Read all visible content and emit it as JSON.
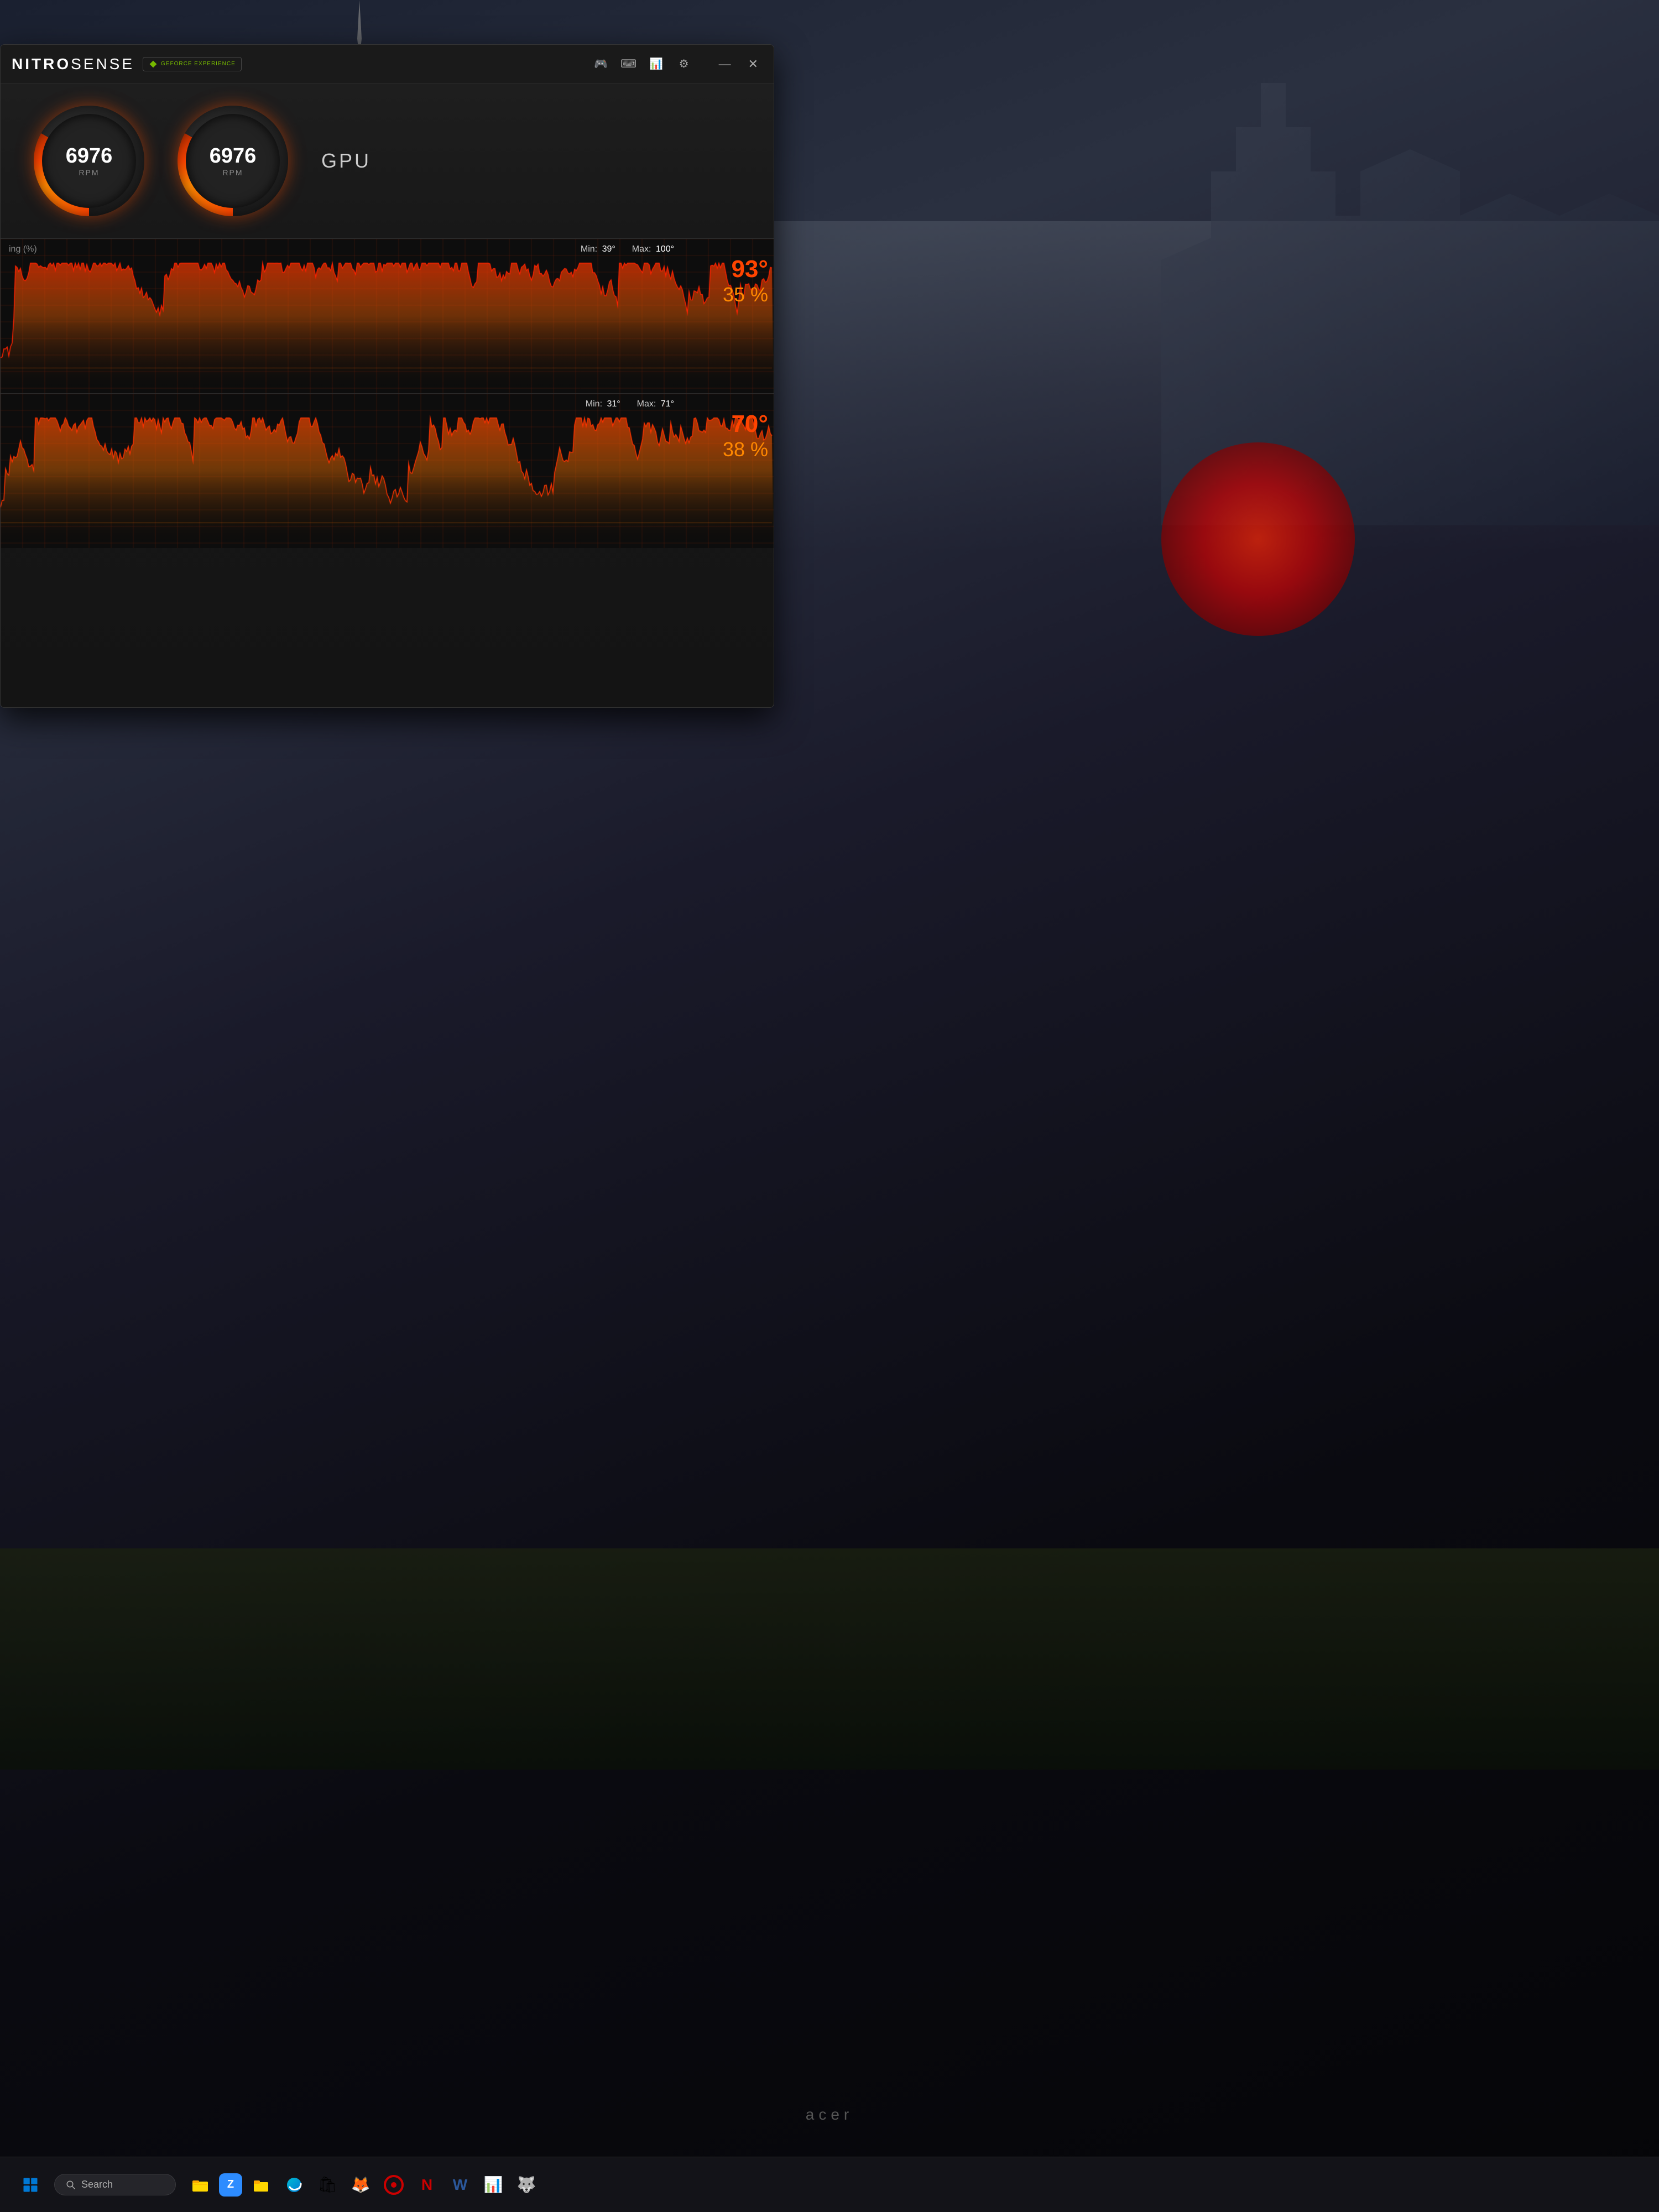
{
  "app": {
    "title_prefix": "NITRO",
    "title_suffix": "SENSE",
    "geforce": "GEFORCE EXPERIENCE"
  },
  "window": {
    "minimize": "—",
    "close": "✕"
  },
  "fans": [
    {
      "rpm": "6976",
      "unit": "RPM"
    },
    {
      "rpm": "6976",
      "unit": "RPM"
    }
  ],
  "gpu_label": "GPU",
  "graphs": [
    {
      "label": "ing (%)",
      "min_label": "Min:",
      "min_value": "39°",
      "max_label": "Max:",
      "max_value": "100°",
      "temp": "93°",
      "percent": "35 %",
      "color_temp": "#ff3300",
      "color_pct": "#ff8800"
    },
    {
      "label": "",
      "min_label": "Min:",
      "min_value": "31°",
      "max_label": "Max:",
      "max_value": "71°",
      "temp": "70°",
      "percent": "38 %",
      "color_temp": "#ff3300",
      "color_pct": "#ff8800"
    }
  ],
  "taskbar": {
    "search_placeholder": "Search",
    "icons": [
      {
        "name": "windows-start",
        "symbol": "⊞",
        "color": "#0078d4"
      },
      {
        "name": "search",
        "label": "Search"
      },
      {
        "name": "file-explorer",
        "symbol": "📁",
        "color": "#ffd700"
      },
      {
        "name": "zoom",
        "symbol": "Z",
        "color": "#2d8cff"
      },
      {
        "name": "files-app",
        "symbol": "📂",
        "color": "#ffd700"
      },
      {
        "name": "edge",
        "symbol": "e",
        "color": "#0078d4"
      },
      {
        "name": "store",
        "symbol": "🛍",
        "color": "#0078d4"
      },
      {
        "name": "firefox",
        "symbol": "🦊",
        "color": "#ff6611"
      },
      {
        "name": "circle-app",
        "symbol": "○",
        "color": "#cc0000"
      },
      {
        "name": "nitro-n",
        "symbol": "N",
        "color": "#cc0000"
      },
      {
        "name": "word",
        "symbol": "W",
        "color": "#2b579a"
      },
      {
        "name": "chart-app",
        "symbol": "📊",
        "color": "#217346"
      },
      {
        "name": "wolf-app",
        "symbol": "🐺",
        "color": "#cc44cc"
      }
    ]
  },
  "laptop_brand": "acer"
}
